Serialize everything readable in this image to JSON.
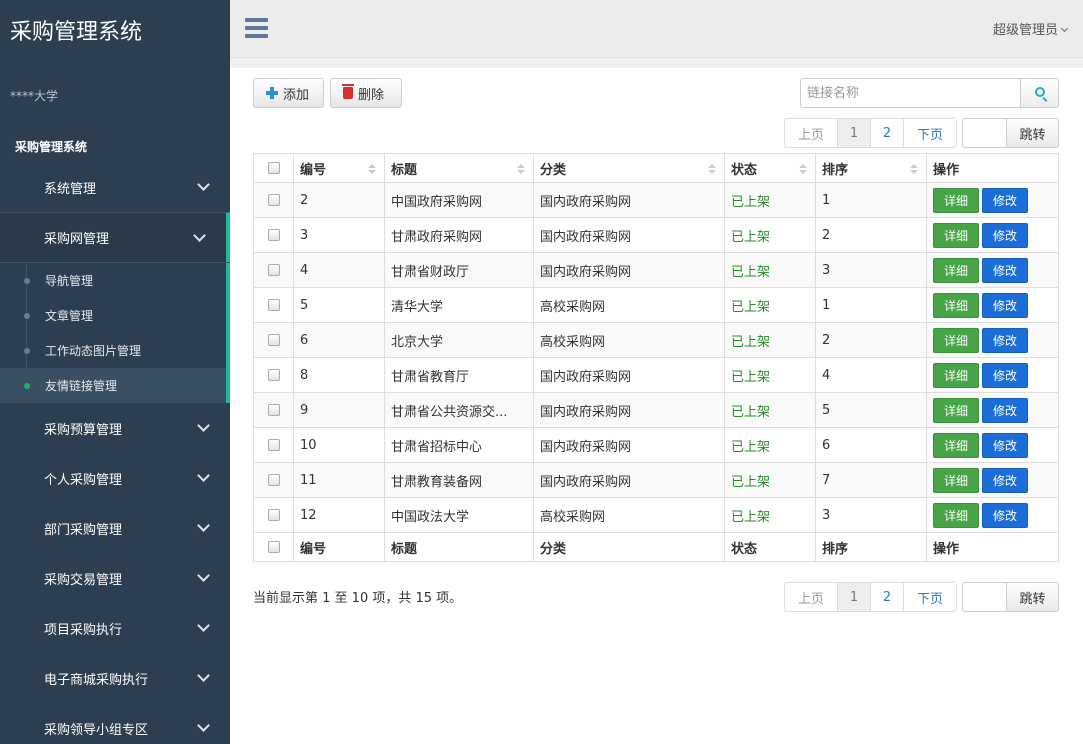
{
  "app": {
    "title": "采购管理系统",
    "org": "****大学",
    "section_label": "采购管理系统"
  },
  "sidebar": {
    "items_top": [
      {
        "label": "系统管理"
      },
      {
        "label": "采购网管理"
      }
    ],
    "subitems": [
      {
        "label": "导航管理"
      },
      {
        "label": "文章管理"
      },
      {
        "label": "工作动态图片管理"
      },
      {
        "label": "友情链接管理"
      }
    ],
    "items_bottom": [
      {
        "label": "采购预算管理"
      },
      {
        "label": "个人采购管理"
      },
      {
        "label": "部门采购管理"
      },
      {
        "label": "采购交易管理"
      },
      {
        "label": "项目采购执行"
      },
      {
        "label": "电子商城采购执行"
      },
      {
        "label": "采购领导小组专区"
      }
    ]
  },
  "header": {
    "user": "超级管理员"
  },
  "toolbar": {
    "add_label": "添加",
    "delete_label": "删除",
    "search_placeholder": "链接名称"
  },
  "pager": {
    "prev": "上页",
    "pages": [
      "1",
      "2"
    ],
    "next": "下页",
    "jump": "跳转"
  },
  "table": {
    "columns": [
      "编号",
      "标题",
      "分类",
      "状态",
      "排序",
      "操作"
    ],
    "detail_label": "详细",
    "edit_label": "修改",
    "rows": [
      {
        "id": "2",
        "title": "中国政府采购网",
        "category": "国内政府采购网",
        "status": "已上架",
        "order": "1"
      },
      {
        "id": "3",
        "title": "甘肃政府采购网",
        "category": "国内政府采购网",
        "status": "已上架",
        "order": "2"
      },
      {
        "id": "4",
        "title": "甘肃省财政厅",
        "category": "国内政府采购网",
        "status": "已上架",
        "order": "3"
      },
      {
        "id": "5",
        "title": "清华大学",
        "category": "高校采购网",
        "status": "已上架",
        "order": "1"
      },
      {
        "id": "6",
        "title": "北京大学",
        "category": "高校采购网",
        "status": "已上架",
        "order": "2"
      },
      {
        "id": "8",
        "title": "甘肃省教育厅",
        "category": "国内政府采购网",
        "status": "已上架",
        "order": "4"
      },
      {
        "id": "9",
        "title": "甘肃省公共资源交...",
        "category": "国内政府采购网",
        "status": "已上架",
        "order": "5"
      },
      {
        "id": "10",
        "title": "甘肃省招标中心",
        "category": "国内政府采购网",
        "status": "已上架",
        "order": "6"
      },
      {
        "id": "11",
        "title": "甘肃教育装备网",
        "category": "国内政府采购网",
        "status": "已上架",
        "order": "7"
      },
      {
        "id": "12",
        "title": "中国政法大学",
        "category": "高校采购网",
        "status": "已上架",
        "order": "3"
      }
    ]
  },
  "summary": "当前显示第 1 至 10 项，共 15 项。"
}
